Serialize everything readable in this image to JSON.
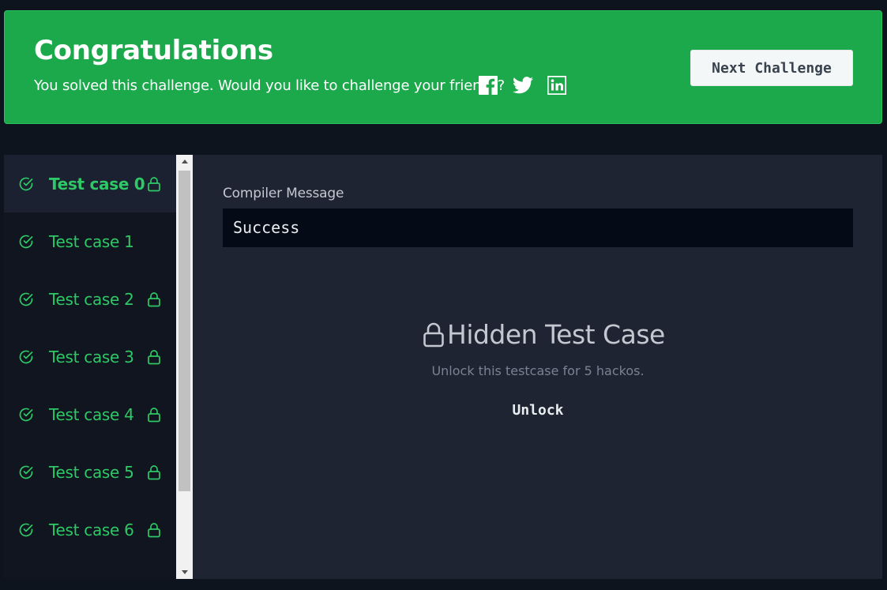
{
  "banner": {
    "title": "Congratulations",
    "subtitle": "You solved this challenge. Would you like to challenge your friends?",
    "share_icons": [
      "facebook-icon",
      "twitter-icon",
      "linkedin-icon"
    ],
    "next_button": "Next Challenge",
    "color": "#1ba94c"
  },
  "sidebar": {
    "items": [
      {
        "label": "Test case 0",
        "status": "passed",
        "locked": true,
        "active": true
      },
      {
        "label": "Test case 1",
        "status": "passed",
        "locked": false,
        "active": false
      },
      {
        "label": "Test case 2",
        "status": "passed",
        "locked": true,
        "active": false
      },
      {
        "label": "Test case 3",
        "status": "passed",
        "locked": true,
        "active": false
      },
      {
        "label": "Test case 4",
        "status": "passed",
        "locked": true,
        "active": false
      },
      {
        "label": "Test case 5",
        "status": "passed",
        "locked": true,
        "active": false
      },
      {
        "label": "Test case 6",
        "status": "passed",
        "locked": true,
        "active": false
      }
    ],
    "accent_color": "#2ec866"
  },
  "main": {
    "compiler_label": "Compiler Message",
    "compiler_output": "Success",
    "hidden_title": "Hidden Test Case",
    "hidden_desc": "Unlock this testcase for 5 hackos.",
    "unlock_button": "Unlock"
  }
}
